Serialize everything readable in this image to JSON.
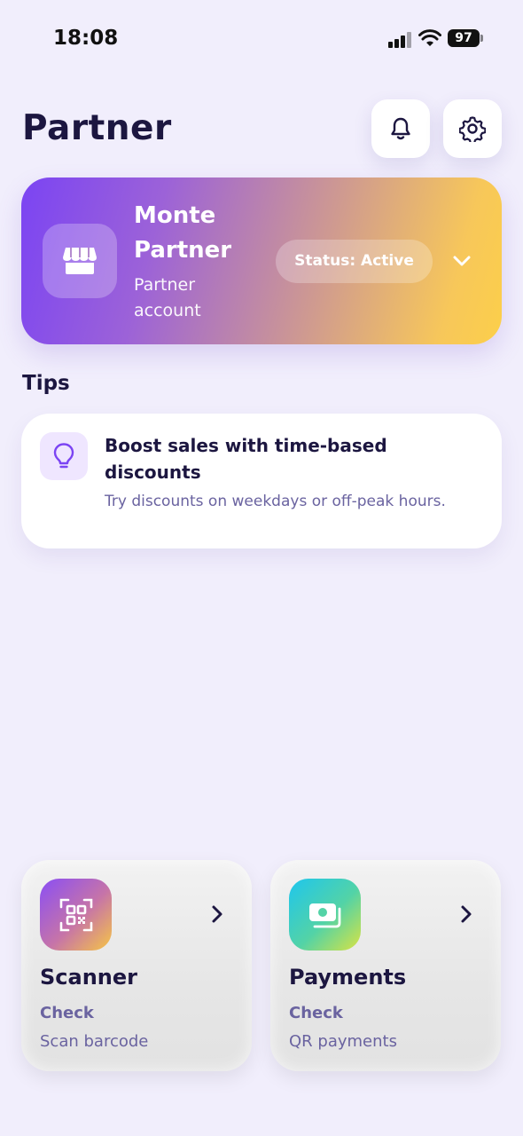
{
  "status_bar": {
    "time": "18:08",
    "battery": "97",
    "icons": [
      "signal-icon",
      "wifi-icon",
      "battery-icon"
    ]
  },
  "header": {
    "title": "Partner",
    "icons": [
      "bell-icon",
      "gear-icon"
    ]
  },
  "partner_card": {
    "name": "Monte Partner",
    "subtitle": "Partner account",
    "status": "Status: Active",
    "icon": "store-icon",
    "gradient": [
      "#7b44f3",
      "#fccf4a"
    ]
  },
  "tips": {
    "title": "Tips",
    "items": [
      {
        "icon": "lightbulb-icon",
        "title": "Boost sales with time-based discounts",
        "body": "Try discounts on weekdays or off-peak hours."
      }
    ]
  },
  "actions": [
    {
      "title": "Scanner",
      "label": "Check",
      "subtitle": "Scan barcode",
      "icon": "qr-scan-icon"
    },
    {
      "title": "Payments",
      "label": "Check",
      "subtitle": "QR payments",
      "icon": "money-icon"
    }
  ],
  "colors": {
    "background": "#f1eefc",
    "text_primary": "#1c1640",
    "text_secondary": "#6a63a0",
    "accent": "#7b44f3"
  }
}
